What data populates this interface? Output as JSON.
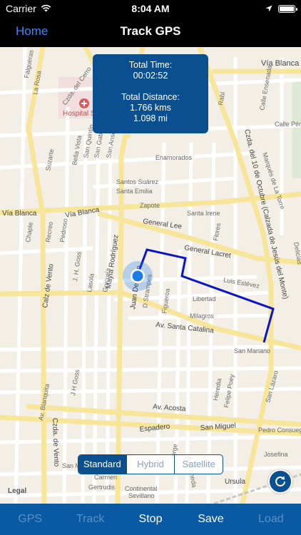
{
  "status_bar": {
    "carrier": "Carrier",
    "time": "8:04 AM",
    "icons": [
      "wifi-icon",
      "location-arrow-icon",
      "battery-icon"
    ]
  },
  "nav": {
    "back_label": "Home",
    "title": "Track GPS"
  },
  "info": {
    "time_label": "Total Time:",
    "time_value": "00:02:52",
    "distance_label": "Total Distance:",
    "distance_kms": "1.766 kms",
    "distance_mi": "1.098 mi"
  },
  "map": {
    "legal": "Legal",
    "labels": [
      "Czda. del Cerro",
      "Vía Blanca",
      "Fálgueras",
      "La Rosa",
      "Hospital Salvador A...",
      "Calle Ensenada",
      "Calle Pérez",
      "Rabí",
      "Suzarte",
      "Bella Vista",
      "San Quintín",
      "San Gabriel",
      "San Anselmo",
      "Enamorados",
      "Santos Suárez",
      "Santa Emilia",
      "Zapote",
      "Santa Irene",
      "General Lee",
      "General Lacret",
      "Flores",
      "Luis Estévez",
      "Libertad",
      "Milagros",
      "Av. Santa Catalina",
      "San Mariano",
      "Calz de Vento",
      "Czda. de Vento",
      "Av. Acosta",
      "Espadero",
      "San Miguel",
      "Heredia",
      "Felipe Poey",
      "San Lázaro",
      "Pedro Consuegra",
      "Josefina",
      "Ursula",
      "Continental",
      "Sevillano",
      "Mayía Rodríguez",
      "Juan Delgado",
      "D Strampes",
      "Figueroa",
      "Goicuría",
      "J. H. Goss",
      "Lasola",
      "Recreo",
      "Pedroso",
      "Chaple",
      "Czda. del 10 de Octubre (Calzada de Jesús del Monte)",
      "Marqués de La Torre",
      "Delicias",
      "Av. Blanquita",
      "J H Goss",
      "Avellaneda",
      "Jorge",
      "Carmen",
      "Gertrudis",
      "San M"
    ]
  },
  "map_type": {
    "options": [
      "Standard",
      "Hybrid",
      "Satellite"
    ],
    "selected": "Standard"
  },
  "toolbar": {
    "gps": "GPS",
    "track": "Track",
    "stop": "Stop",
    "save": "Save",
    "load": "Load"
  },
  "colors": {
    "accent": "#0a4f8f",
    "toolbar": "#0a5aa3",
    "track_line": "#0a14c8",
    "location_dot": "#1a7ce8",
    "home_link": "#2f8cff"
  }
}
